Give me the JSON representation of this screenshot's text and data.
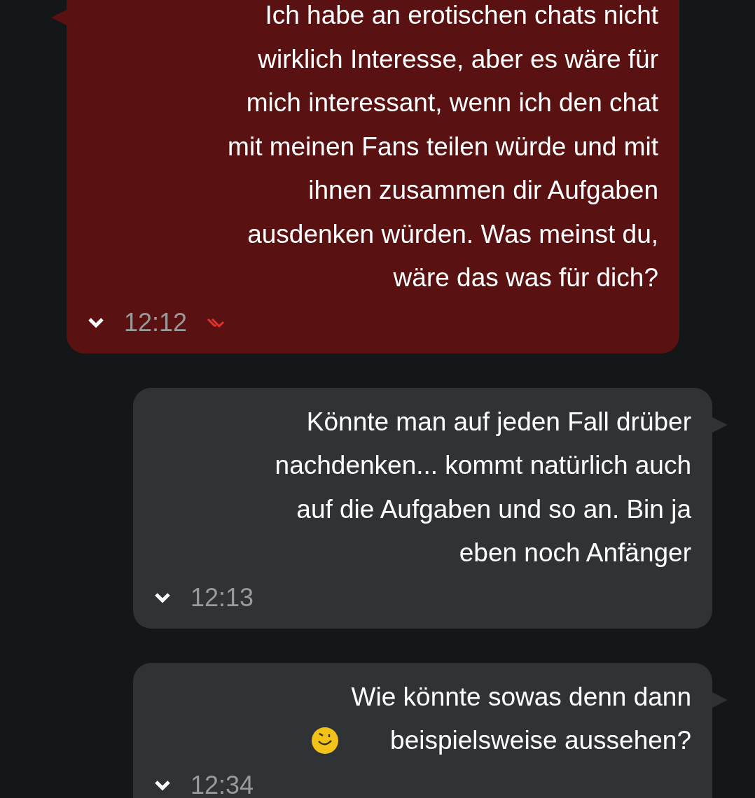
{
  "messages": [
    {
      "kind": "outgoing",
      "text": "Ich habe an erotischen chats nicht\nwirklich Interesse, aber es wäre für\nmich interessant, wenn ich den chat\nmit meinen Fans teilen würde und mit\nihnen zusammen dir Aufgaben\nausdenken würden. Was meinst du,\nwäre das was für dich?",
      "time": "12:12",
      "read": true
    },
    {
      "kind": "incoming",
      "text": "Könnte man auf jeden Fall drüber\nnachdenken... kommt natürlich auch\nauf die Aufgaben und so an. Bin ja\neben noch Anfänger",
      "time": "12:13"
    },
    {
      "kind": "incoming",
      "text": "Wie könnte sowas denn dann\nbeispielsweise aussehen?",
      "emoji": true,
      "time": "12:34"
    }
  ]
}
